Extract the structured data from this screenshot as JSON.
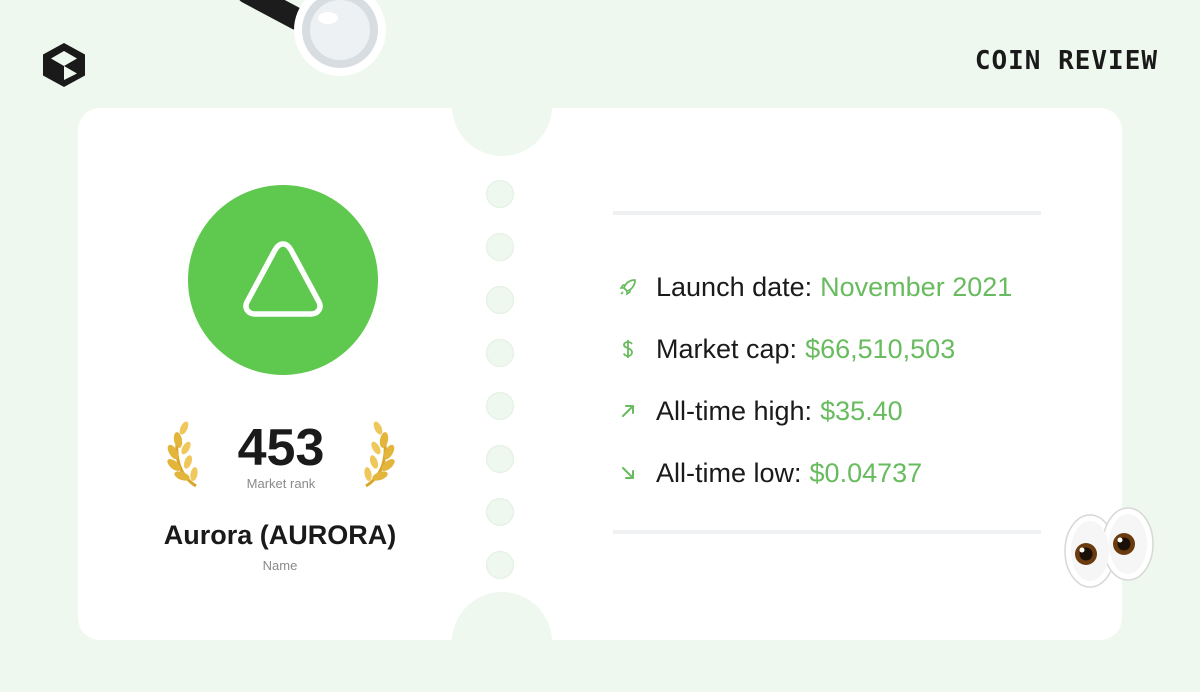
{
  "header": {
    "brand": "COIN REVIEW",
    "logo_icon": "hexagon-logo-icon",
    "decoration_icon": "magnifying-glass-icon"
  },
  "coin": {
    "icon": "aurora-triangle-icon",
    "rank": "453",
    "rank_label": "Market rank",
    "name": "Aurora (AURORA)",
    "name_label": "Name"
  },
  "stats": [
    {
      "icon": "rocket-icon",
      "label": "Launch date:",
      "value": "November 2021"
    },
    {
      "icon": "dollar-icon",
      "label": "Market cap:",
      "value": "$66,510,503"
    },
    {
      "icon": "arrow-up-right-icon",
      "label": "All-time high:",
      "value": "$35.40"
    },
    {
      "icon": "arrow-down-right-icon",
      "label": "All-time low:",
      "value": "$0.04737"
    }
  ],
  "decorations": {
    "eyes_icon": "eyes-emoji-icon"
  },
  "colors": {
    "background": "#eef8ee",
    "accent": "#68bb5e",
    "coin": "#5fc84e",
    "laurel": "#e3b53a",
    "text": "#1a1a1a"
  }
}
